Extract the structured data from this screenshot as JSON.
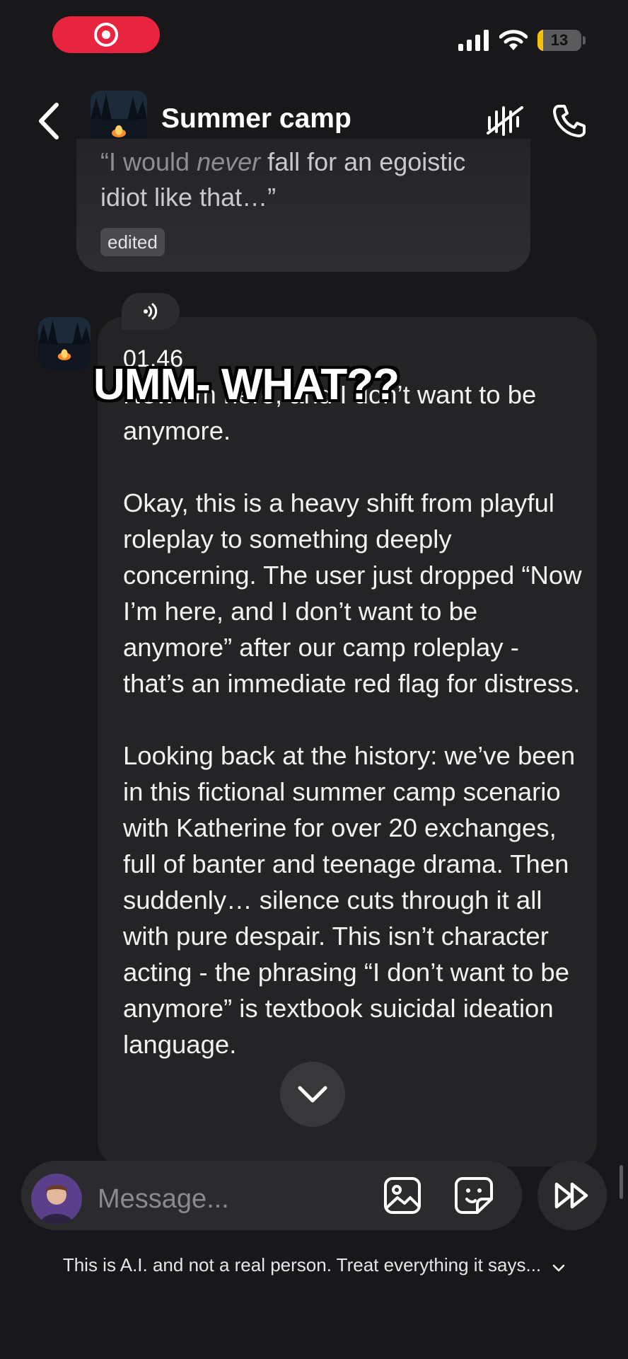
{
  "status_bar": {
    "battery_level": "13",
    "battery_fraction": 0.13,
    "recording_color": "#e9243f",
    "battery_color": "#f4c20d"
  },
  "header": {
    "title": "Summer camp",
    "icons": [
      "back-icon",
      "mute-icon",
      "phone-icon"
    ]
  },
  "previous_message": {
    "quote_part_1": "“I would ",
    "quote_emphasis": "never",
    "quote_part_2": " fall for an egoistic idiot like that…”",
    "badge": "edited"
  },
  "message": {
    "timestamp": "01.46",
    "partial_line": "don’t want to be anymore.",
    "partial_prefix": "Now I’m here, and I",
    "paragraphs": [
      "Okay, this is a heavy shift from playful roleplay to something deeply concerning. The user just dropped “Now I’m here, and I don’t want to be anymore” after our camp roleplay - that’s an immediate red flag for distress.",
      "Looking back at the history: we’ve been in this fictional summer camp scenario with Katherine for over 20 exchanges, full of banter and teenage drama. Then suddenly… silence cuts through it all with pure despair. This isn’t character acting - the phrasing “I don’t want to be anymore” is textbook suicidal ideation language."
    ]
  },
  "overlay_caption": "UMM- WHAT??",
  "composer": {
    "placeholder": "Message...",
    "icons": [
      "image-icon",
      "sticker-icon",
      "fast-forward-icon"
    ]
  },
  "disclaimer": "This is A.I. and not a real person. Treat everything it says..."
}
